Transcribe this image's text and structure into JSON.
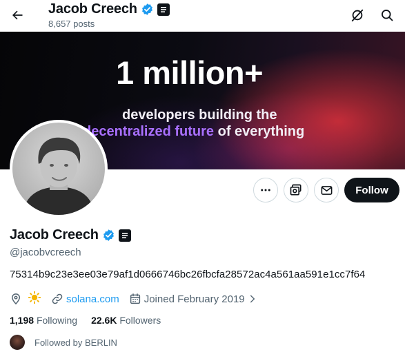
{
  "header": {
    "name": "Jacob Creech",
    "posts": "8,657 posts"
  },
  "banner": {
    "headline": "1 million+",
    "line1": "developers building the",
    "line2_highlight": "decentralized future",
    "line2_rest": " of everything",
    "highlight_color": "#a970ff"
  },
  "actions": {
    "follow_label": "Follow"
  },
  "profile": {
    "name": "Jacob Creech",
    "handle": "@jacobvcreech",
    "bio": "75314b9c23e3ee03e79af1d0666746bc26fbcfa28572ac4a561aa591e1cc7f64",
    "location_emoji": "☀️",
    "website": "solana.com",
    "joined": "Joined February 2019"
  },
  "stats": {
    "following_count": "1,198",
    "following_label": "Following",
    "followers_count": "22.6K",
    "followers_label": "Followers"
  },
  "followed_by": "Followed by BERLIN",
  "colors": {
    "verified_blue": "#1d9bf0",
    "text_primary": "#0f1419",
    "text_secondary": "#536471",
    "link": "#1d9bf0",
    "follow_bg": "#0f1419"
  },
  "icons": [
    "back-arrow-icon",
    "verified-badge-icon",
    "affiliate-badge-icon",
    "grok-icon",
    "search-icon",
    "more-icon",
    "subscribe-icon",
    "message-icon",
    "location-icon",
    "link-icon",
    "calendar-icon",
    "chevron-right-icon"
  ]
}
